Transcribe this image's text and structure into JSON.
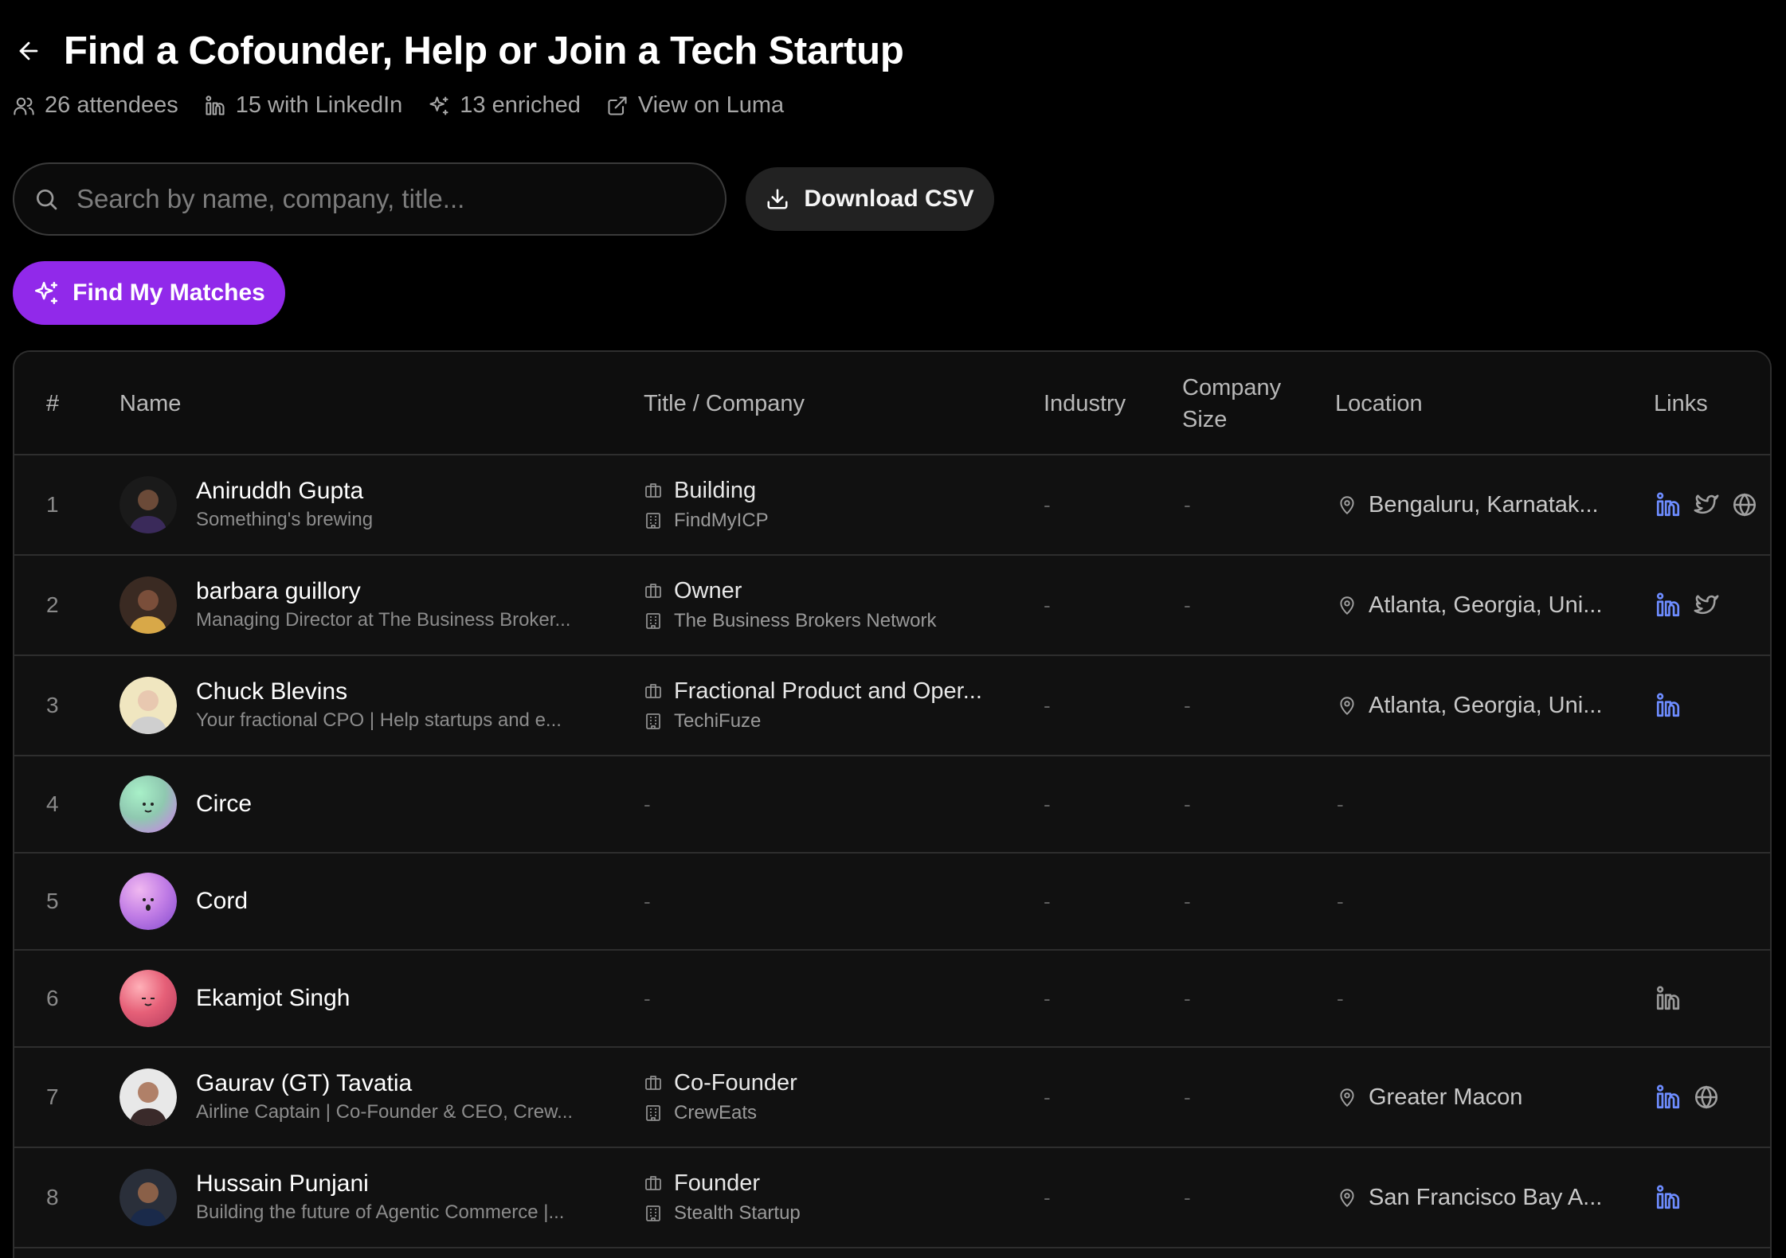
{
  "page": {
    "title": "Find a Cofounder, Help or Join a Tech Startup",
    "attendees": "26 attendees",
    "linkedin_count": "15 with LinkedIn",
    "enriched": "13 enriched",
    "view_luma": "View on Luma"
  },
  "search": {
    "placeholder": "Search by name, company, title..."
  },
  "actions": {
    "download_csv": "Download CSV",
    "find_matches": "Find My Matches"
  },
  "colors": {
    "accent": "#9129ea",
    "link_blue": "#6d8cff",
    "background": "#000000"
  },
  "table": {
    "headers": {
      "num": "#",
      "name": "Name",
      "title_company": "Title / Company",
      "industry": "Industry",
      "company_size_1": "Company",
      "company_size_2": "Size",
      "location": "Location",
      "links": "Links"
    },
    "rows": [
      {
        "num": "1",
        "name": "Aniruddh Gupta",
        "sub": "Something's brewing",
        "title": "Building",
        "company": "FindMyICP",
        "industry": "-",
        "size": "-",
        "location": "Bengaluru, Karnatak...",
        "links": [
          "linkedin-icon",
          "twitter-icon",
          "globe-icon"
        ],
        "avatar": "photo"
      },
      {
        "num": "2",
        "name": "barbara guillory",
        "sub": "Managing Director at The Business Broker...",
        "title": "Owner",
        "company": "The Business Brokers Network",
        "industry": "-",
        "size": "-",
        "location": "Atlanta, Georgia, Uni...",
        "links": [
          "linkedin-icon",
          "twitter-icon"
        ],
        "avatar": "photo"
      },
      {
        "num": "3",
        "name": "Chuck Blevins",
        "sub": "Your fractional CPO | Help startups and e...",
        "title": "Fractional Product and Oper...",
        "company": "TechiFuze",
        "industry": "-",
        "size": "-",
        "location": "Atlanta, Georgia, Uni...",
        "links": [
          "linkedin-icon"
        ],
        "avatar": "photo"
      },
      {
        "num": "4",
        "name": "Circe",
        "sub": "",
        "title": "-",
        "company": "",
        "industry": "-",
        "size": "-",
        "location": "-",
        "links": [],
        "avatar": "green"
      },
      {
        "num": "5",
        "name": "Cord",
        "sub": "",
        "title": "-",
        "company": "",
        "industry": "-",
        "size": "-",
        "location": "-",
        "links": [],
        "avatar": "purple"
      },
      {
        "num": "6",
        "name": "Ekamjot Singh",
        "sub": "",
        "title": "-",
        "company": "",
        "industry": "-",
        "size": "-",
        "location": "-",
        "links": [
          "linkedin-icon-muted"
        ],
        "avatar": "red"
      },
      {
        "num": "7",
        "name": "Gaurav (GT) Tavatia",
        "sub": "Airline Captain | Co-Founder & CEO, Crew...",
        "title": "Co-Founder",
        "company": "CrewEats",
        "industry": "-",
        "size": "-",
        "location": "Greater Macon",
        "links": [
          "linkedin-icon",
          "globe-icon"
        ],
        "avatar": "photo"
      },
      {
        "num": "8",
        "name": "Hussain Punjani",
        "sub": "Building the future of Agentic Commerce |...",
        "title": "Founder",
        "company": "Stealth Startup",
        "industry": "-",
        "size": "-",
        "location": "San Francisco Bay A...",
        "links": [
          "linkedin-icon"
        ],
        "avatar": "photo"
      }
    ]
  }
}
